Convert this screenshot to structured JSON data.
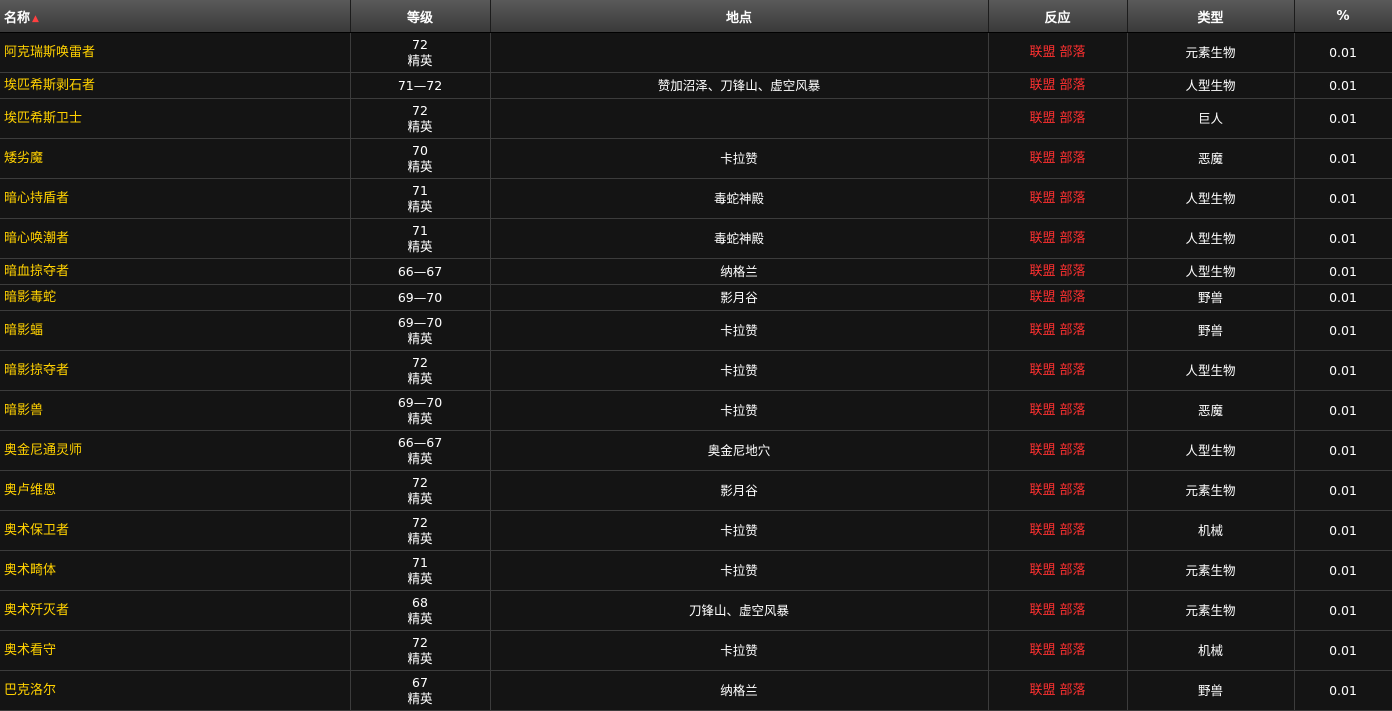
{
  "header": {
    "name": "名称",
    "sort_indicator": "▲",
    "level": "等级",
    "location": "地点",
    "reaction": "反应",
    "type": "类型",
    "percent": "%"
  },
  "reaction_labels": {
    "alliance": "联盟",
    "horde": "部落"
  },
  "colors": {
    "npc_name": "#ffd100",
    "hostile_reaction": "#ff3030",
    "header_bg": "#4a4a4a",
    "row_bg": "#141414"
  },
  "rows": [
    {
      "name": "阿克瑞斯唤雷者",
      "level": "72",
      "elite": "精英",
      "location": "",
      "type": "元素生物",
      "percent": "0.01"
    },
    {
      "name": "埃匹希斯剥石者",
      "level": "71—72",
      "elite": "",
      "location": "赞加沼泽、刀锋山、虚空风暴",
      "type": "人型生物",
      "percent": "0.01"
    },
    {
      "name": "埃匹希斯卫士",
      "level": "72",
      "elite": "精英",
      "location": "",
      "type": "巨人",
      "percent": "0.01"
    },
    {
      "name": "矮劣魔",
      "level": "70",
      "elite": "精英",
      "location": "卡拉赞",
      "type": "恶魔",
      "percent": "0.01"
    },
    {
      "name": "暗心持盾者",
      "level": "71",
      "elite": "精英",
      "location": "毒蛇神殿",
      "type": "人型生物",
      "percent": "0.01"
    },
    {
      "name": "暗心唤潮者",
      "level": "71",
      "elite": "精英",
      "location": "毒蛇神殿",
      "type": "人型生物",
      "percent": "0.01"
    },
    {
      "name": "暗血掠夺者",
      "level": "66—67",
      "elite": "",
      "location": "纳格兰",
      "type": "人型生物",
      "percent": "0.01"
    },
    {
      "name": "暗影毒蛇",
      "level": "69—70",
      "elite": "",
      "location": "影月谷",
      "type": "野兽",
      "percent": "0.01"
    },
    {
      "name": "暗影蝠",
      "level": "69—70",
      "elite": "精英",
      "location": "卡拉赞",
      "type": "野兽",
      "percent": "0.01"
    },
    {
      "name": "暗影掠夺者",
      "level": "72",
      "elite": "精英",
      "location": "卡拉赞",
      "type": "人型生物",
      "percent": "0.01"
    },
    {
      "name": "暗影兽",
      "level": "69—70",
      "elite": "精英",
      "location": "卡拉赞",
      "type": "恶魔",
      "percent": "0.01"
    },
    {
      "name": "奥金尼通灵师",
      "level": "66—67",
      "elite": "精英",
      "location": "奥金尼地穴",
      "type": "人型生物",
      "percent": "0.01"
    },
    {
      "name": "奥卢维恩",
      "level": "72",
      "elite": "精英",
      "location": "影月谷",
      "type": "元素生物",
      "percent": "0.01"
    },
    {
      "name": "奥术保卫者",
      "level": "72",
      "elite": "精英",
      "location": "卡拉赞",
      "type": "机械",
      "percent": "0.01"
    },
    {
      "name": "奥术畸体",
      "level": "71",
      "elite": "精英",
      "location": "卡拉赞",
      "type": "元素生物",
      "percent": "0.01"
    },
    {
      "name": "奥术歼灭者",
      "level": "68",
      "elite": "精英",
      "location": "刀锋山、虚空风暴",
      "type": "元素生物",
      "percent": "0.01"
    },
    {
      "name": "奥术看守",
      "level": "72",
      "elite": "精英",
      "location": "卡拉赞",
      "type": "机械",
      "percent": "0.01"
    },
    {
      "name": "巴克洛尔",
      "level": "67",
      "elite": "精英",
      "location": "纳格兰",
      "type": "野兽",
      "percent": "0.01"
    }
  ]
}
